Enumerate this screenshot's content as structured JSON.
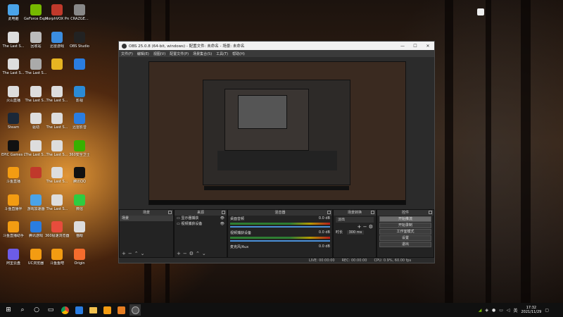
{
  "desktop": {
    "icons": [
      {
        "label": "此电脑",
        "color": "#4aa3e8"
      },
      {
        "label": "GeForce Experience",
        "color": "#76b900"
      },
      {
        "label": "MorphVOX Pro",
        "color": "#c0392b"
      },
      {
        "label": "CRAZGE...",
        "color": "#888"
      },
      {
        "label": "The Last S...",
        "color": "#ddd"
      },
      {
        "label": "回收站",
        "color": "#bbb"
      },
      {
        "label": "迅雷游戏",
        "color": "#3b8de0"
      },
      {
        "label": "OBS Studio",
        "color": "#222"
      },
      {
        "label": "The Last S...",
        "color": "#ddd"
      },
      {
        "label": "The Last S...",
        "color": "#aaa"
      },
      {
        "label": "",
        "color": "#e6b422"
      },
      {
        "label": "",
        "color": "#2a7de1"
      },
      {
        "label": "火山直播",
        "color": "#ddd"
      },
      {
        "label": "The Last S...",
        "color": "#ddd"
      },
      {
        "label": "The Last S...",
        "color": "#ddd"
      },
      {
        "label": "影视",
        "color": "#2b8bd6"
      },
      {
        "label": "Steam",
        "color": "#1b2838"
      },
      {
        "label": "驱动",
        "color": "#ddd"
      },
      {
        "label": "The Last S...",
        "color": "#ddd"
      },
      {
        "label": "迅雷影音",
        "color": "#2a7de1"
      },
      {
        "label": "EPIC Games Launcher",
        "color": "#111"
      },
      {
        "label": "The Last S...",
        "color": "#ddd"
      },
      {
        "label": "The Last S...",
        "color": "#ddd"
      },
      {
        "label": "360安全卫士",
        "color": "#38b000"
      },
      {
        "label": "斗鱼直播",
        "color": "#f39c12"
      },
      {
        "label": "",
        "color": "#c0392b"
      },
      {
        "label": "The Last S...",
        "color": "#ddd"
      },
      {
        "label": "腾讯QQ",
        "color": "#111"
      },
      {
        "label": "斗鱼直播伴",
        "color": "#f39c12"
      },
      {
        "label": "游戏加速器",
        "color": "#4aa3e8"
      },
      {
        "label": "The Last S...",
        "color": "#ddd"
      },
      {
        "label": "微信",
        "color": "#2ecc40"
      },
      {
        "label": "斗鱼直播助手",
        "color": "#f39c12"
      },
      {
        "label": "腾讯游戏",
        "color": "#2a7de1"
      },
      {
        "label": "360极速浏览器",
        "color": "#e74c3c"
      },
      {
        "label": "猫眼",
        "color": "#ddd"
      },
      {
        "label": "阿里云盘",
        "color": "#6c5ce7"
      },
      {
        "label": "UC浏览器",
        "color": "#f39c12"
      },
      {
        "label": "斗鱼鱼吧",
        "color": "#f39c12"
      },
      {
        "label": "Origin",
        "color": "#f56c2d"
      }
    ]
  },
  "obs": {
    "title": "OBS 25.0.8 (64-bit, windows) - 配置文件: 未命名 - 场景: 未命名",
    "window_buttons": [
      "—",
      "☐",
      "✕"
    ],
    "menu": [
      "文件(F)",
      "编辑(E)",
      "视图(V)",
      "配置文件(P)",
      "场景集合(S)",
      "工具(T)",
      "帮助(H)"
    ],
    "docks": {
      "scenes": {
        "title": "场景",
        "items": [
          "场景"
        ]
      },
      "sources": {
        "title": "来源",
        "items": [
          "显示器捕获",
          "视频捕获设备"
        ]
      },
      "mixer": {
        "title": "混音器",
        "tracks": [
          {
            "name": "桌面音频",
            "db": "0.0 dB"
          },
          {
            "name": "视频捕获设备",
            "db": "0.0 dB"
          },
          {
            "name": "麦克风/Aux",
            "db": "0.0 dB"
          }
        ]
      },
      "transitions": {
        "title": "场景转换",
        "type": "淡出",
        "duration_label": "时长",
        "duration_value": "300 ms"
      },
      "controls": {
        "title": "控件",
        "buttons": [
          "开始推流",
          "开始录制",
          "工作室模式",
          "设置",
          "退出"
        ]
      }
    },
    "status": {
      "live": "LIVE: 00:00:00",
      "rec": "REC: 00:00:00",
      "cpu": "CPU: 0.9%, 60.00 fps"
    }
  },
  "taskbar": {
    "time": "17:32",
    "date": "2021/11/29",
    "input_method": "英"
  }
}
